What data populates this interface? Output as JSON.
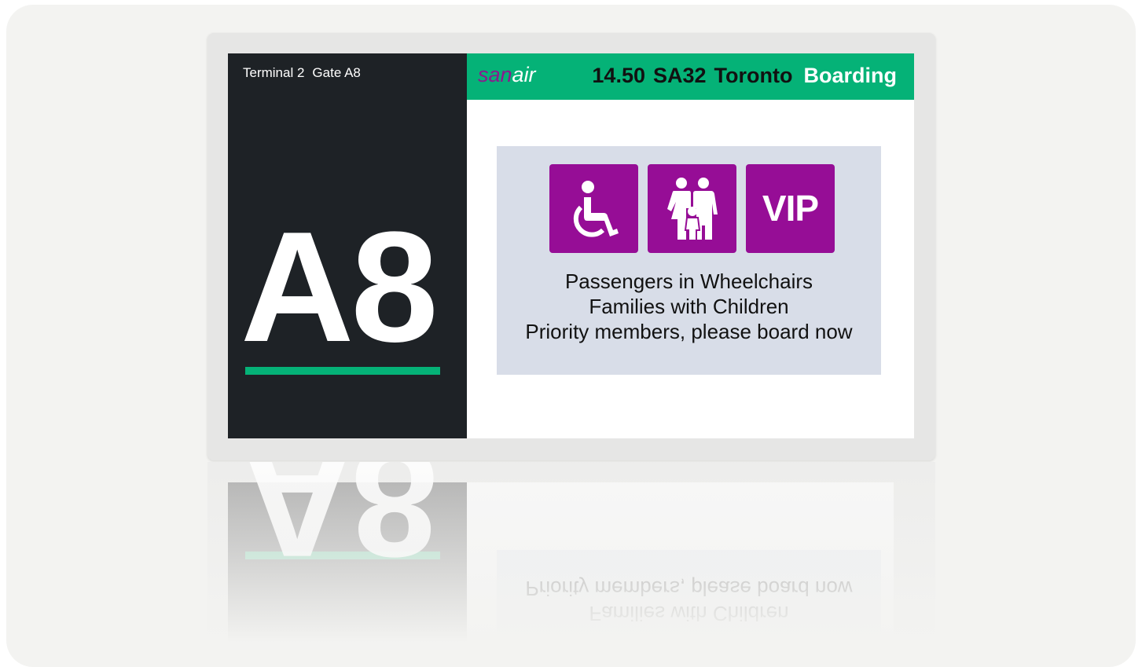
{
  "display": {
    "terminal": "Terminal 2",
    "gate_label": "Gate A8",
    "gate_code": "A8",
    "brand": {
      "part1": "san",
      "part2": "air"
    },
    "flight": {
      "time": "14.50",
      "number": "SA32",
      "destination": "Toronto",
      "status": "Boarding"
    },
    "notice": {
      "icons": [
        "wheelchair-icon",
        "family-icon",
        "vip-icon"
      ],
      "vip_label": "VIP",
      "lines": [
        "Passengers in Wheelchairs",
        "Families with Children",
        "Priority members, please board now"
      ]
    }
  },
  "colors": {
    "accent_green": "#05b277",
    "accent_purple": "#960d96",
    "panel_dark": "#1e2226",
    "notice_bg": "#d8dde8",
    "brand_purple": "#8b1a8e"
  }
}
